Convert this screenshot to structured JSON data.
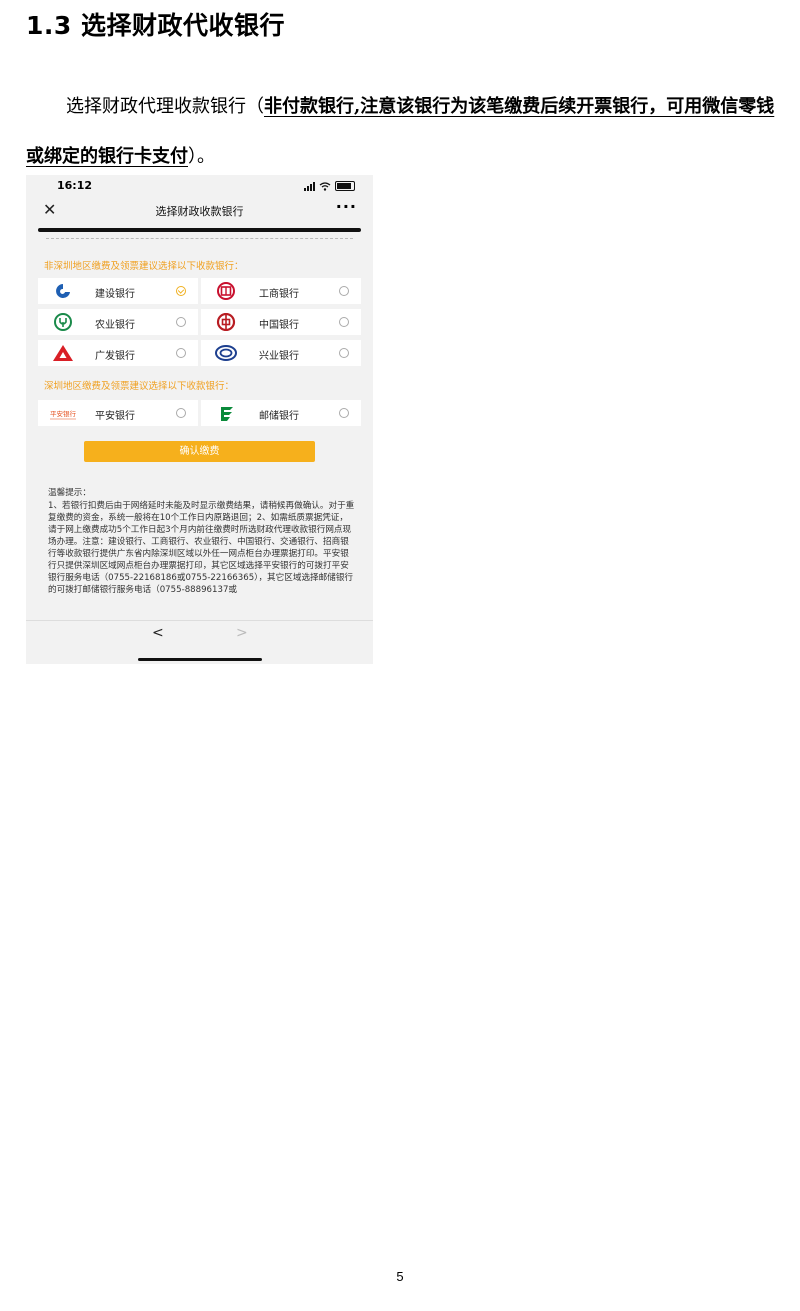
{
  "heading": "1.3 选择财政代收银行",
  "paragraph": {
    "prefix": "选择财政代理收款银行（",
    "emphasis": "非付款银行,注意该银行为该笔缴费后续开票银行，可用微信零钱或绑定的银行卡支付",
    "suffix": "）。"
  },
  "phone": {
    "status_time": "16:12",
    "nav_close": "✕",
    "nav_title": "选择财政收款银行",
    "nav_more": "···",
    "section1_label": "非深圳地区缴费及领票建议选择以下收款银行：",
    "section2_label": "深圳地区缴费及领票建议选择以下收款银行：",
    "banks": {
      "ccb": "建设银行",
      "icbc": "工商银行",
      "abc": "农业银行",
      "boc": "中国银行",
      "cgb": "广发银行",
      "cib": "兴业银行",
      "pab": "平安银行",
      "psbc": "邮储银行"
    },
    "pab_logo_text": "平安银行",
    "confirm_button": "确认缴费",
    "tips_title": "温馨提示：",
    "tips_body": "1、若银行扣费后由于网络延时未能及时显示缴费结果，请稍候再做确认。对于重复缴费的资金，系统一般将在10个工作日内原路退回；2、如需纸质票据凭证，请于网上缴费成功5个工作日起3个月内前往缴费时所选财政代理收款银行网点现场办理。注意：建设银行、工商银行、农业银行、中国银行、交通银行、招商银行等收款银行提供广东省内除深圳区域以外任一网点柜台办理票据打印。平安银行只提供深圳区域网点柜台办理票据打印，其它区域选择平安银行的可拨打平安银行服务电话（0755-22168186或0755-22166365），其它区域选择邮储银行的可拨打邮储银行服务电话（0755-88896137或",
    "back_arrow": "<",
    "forward_arrow": ">"
  },
  "page_number": "5",
  "colors": {
    "accent": "#f6b01c",
    "section_label": "#f0a020",
    "ccb_blue": "#1e5fb3",
    "icbc_red": "#c8102e",
    "abc_green": "#1a8a4a",
    "boc_red": "#b81c22",
    "cgb_red": "#d91f26",
    "cib_blue": "#1d3f8f",
    "psbc_green": "#0a8a3a"
  }
}
